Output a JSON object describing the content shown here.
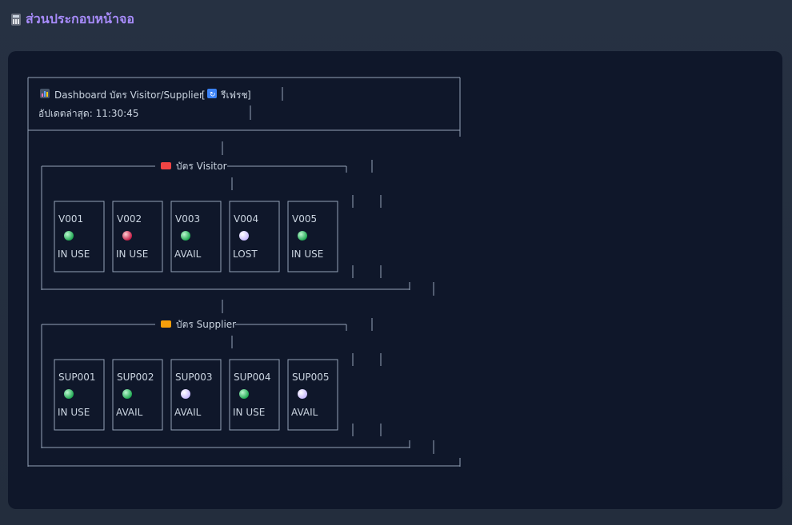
{
  "section": {
    "title": "ส่วนประกอบหน้าจอ",
    "icon": "abacus-icon"
  },
  "dashboard": {
    "title": "Dashboard บัตร Visitor/Supplier",
    "refresh_label": "รีเฟรช",
    "updated_label": "อัปเดตล่าสุด: 11:30:45"
  },
  "groups": [
    {
      "title": "บัตร Visitor",
      "icon": "car-icon",
      "cards": [
        {
          "id": "V001",
          "status": "IN USE",
          "dot": "green"
        },
        {
          "id": "V002",
          "status": "IN USE",
          "dot": "red"
        },
        {
          "id": "V003",
          "status": "AVAIL",
          "dot": "green"
        },
        {
          "id": "V004",
          "status": "LOST",
          "dot": "white"
        },
        {
          "id": "V005",
          "status": "IN USE",
          "dot": "green"
        }
      ]
    },
    {
      "title": "บัตร Supplier",
      "icon": "truck-icon",
      "cards": [
        {
          "id": "SUP001",
          "status": "IN USE",
          "dot": "green"
        },
        {
          "id": "SUP002",
          "status": "AVAIL",
          "dot": "green"
        },
        {
          "id": "SUP003",
          "status": "AVAIL",
          "dot": "white"
        },
        {
          "id": "SUP004",
          "status": "IN USE",
          "dot": "green"
        },
        {
          "id": "SUP005",
          "status": "AVAIL",
          "dot": "white"
        }
      ]
    }
  ],
  "colors": {
    "green": "#22c55e",
    "red": "#e11d48",
    "white": "#e9d5ff",
    "accent": "#a78bfa",
    "line": "#94a3b8"
  }
}
